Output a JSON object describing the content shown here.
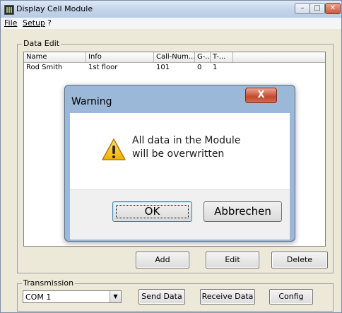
{
  "window": {
    "title": "Display Cell Module"
  },
  "menu": {
    "file": "File",
    "setup": "Setup",
    "help": "?"
  },
  "data_edit": {
    "group_label": "Data Edit",
    "columns": [
      "Name",
      "Info",
      "Call-Num...",
      "G-...",
      "T-..."
    ],
    "rows": [
      [
        "Rod Smith",
        "1st floor",
        "101",
        "0",
        "1"
      ]
    ],
    "buttons": {
      "add": "Add",
      "edit": "Edit",
      "delete": "Delete"
    }
  },
  "transmission": {
    "group_label": "Transmission",
    "port_value": "COM 1",
    "buttons": {
      "send": "Send Data",
      "receive": "Receive Data",
      "config": "Config"
    }
  },
  "dialog": {
    "title": "Warning",
    "close_glyph": "X",
    "icon": "warning-triangle-icon",
    "message_line1": "All data in the Module",
    "message_line2": "will be overwritten",
    "ok": "OK",
    "cancel": "Abbrechen"
  }
}
